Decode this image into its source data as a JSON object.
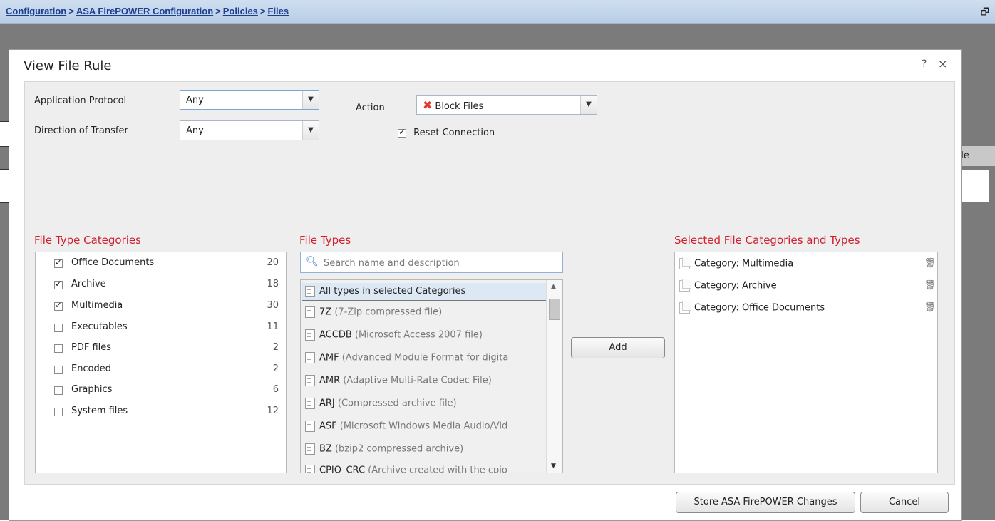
{
  "breadcrumb": {
    "items": [
      "Configuration",
      "ASA FirePOWER Configuration",
      "Policies",
      "Files"
    ],
    "separator": ">"
  },
  "restore_icon": "restore-window-icon",
  "background": {
    "tab_fragment": "ule"
  },
  "dialog": {
    "title": "View File Rule",
    "help": "?",
    "close": "×"
  },
  "form": {
    "app_protocol_label": "Application Protocol",
    "app_protocol_value": "Any",
    "direction_label": "Direction of Transfer",
    "direction_value": "Any",
    "action_label": "Action",
    "action_value": "Block Files",
    "reset_label": "Reset Connection",
    "reset_checked": true
  },
  "categories": {
    "heading": "File Type Categories",
    "items": [
      {
        "name": "Office Documents",
        "count": "20",
        "checked": true
      },
      {
        "name": "Archive",
        "count": "18",
        "checked": true
      },
      {
        "name": "Multimedia",
        "count": "30",
        "checked": true
      },
      {
        "name": "Executables",
        "count": "11",
        "checked": false
      },
      {
        "name": "PDF files",
        "count": "2",
        "checked": false
      },
      {
        "name": "Encoded",
        "count": "2",
        "checked": false
      },
      {
        "name": "Graphics",
        "count": "6",
        "checked": false
      },
      {
        "name": "System files",
        "count": "12",
        "checked": false
      }
    ]
  },
  "types": {
    "heading": "File Types",
    "search_placeholder": "Search name and description",
    "first": "All types in selected Categories",
    "items": [
      {
        "code": "7Z",
        "desc": "(7-Zip compressed file)"
      },
      {
        "code": "ACCDB",
        "desc": "(Microsoft Access 2007 file)"
      },
      {
        "code": "AMF",
        "desc": "(Advanced Module Format for digita"
      },
      {
        "code": "AMR",
        "desc": "(Adaptive Multi-Rate Codec File)"
      },
      {
        "code": "ARJ",
        "desc": "(Compressed archive file)"
      },
      {
        "code": "ASF",
        "desc": "(Microsoft Windows Media Audio/Vid"
      },
      {
        "code": "BZ",
        "desc": "(bzip2 compressed archive)"
      },
      {
        "code": "CPIO_CRC",
        "desc": "(Archive created with the cpio"
      }
    ]
  },
  "add_label": "Add",
  "selected": {
    "heading": "Selected File Categories and Types",
    "items": [
      "Category: Multimedia",
      "Category: Archive",
      "Category: Office Documents"
    ]
  },
  "footer": {
    "store_label": "Store ASA FirePOWER Changes",
    "cancel_label": "Cancel"
  },
  "colors": {
    "section_heading": "#d0202e",
    "breadcrumb": "#1c3f8f",
    "block_icon": "#e23b2e"
  }
}
